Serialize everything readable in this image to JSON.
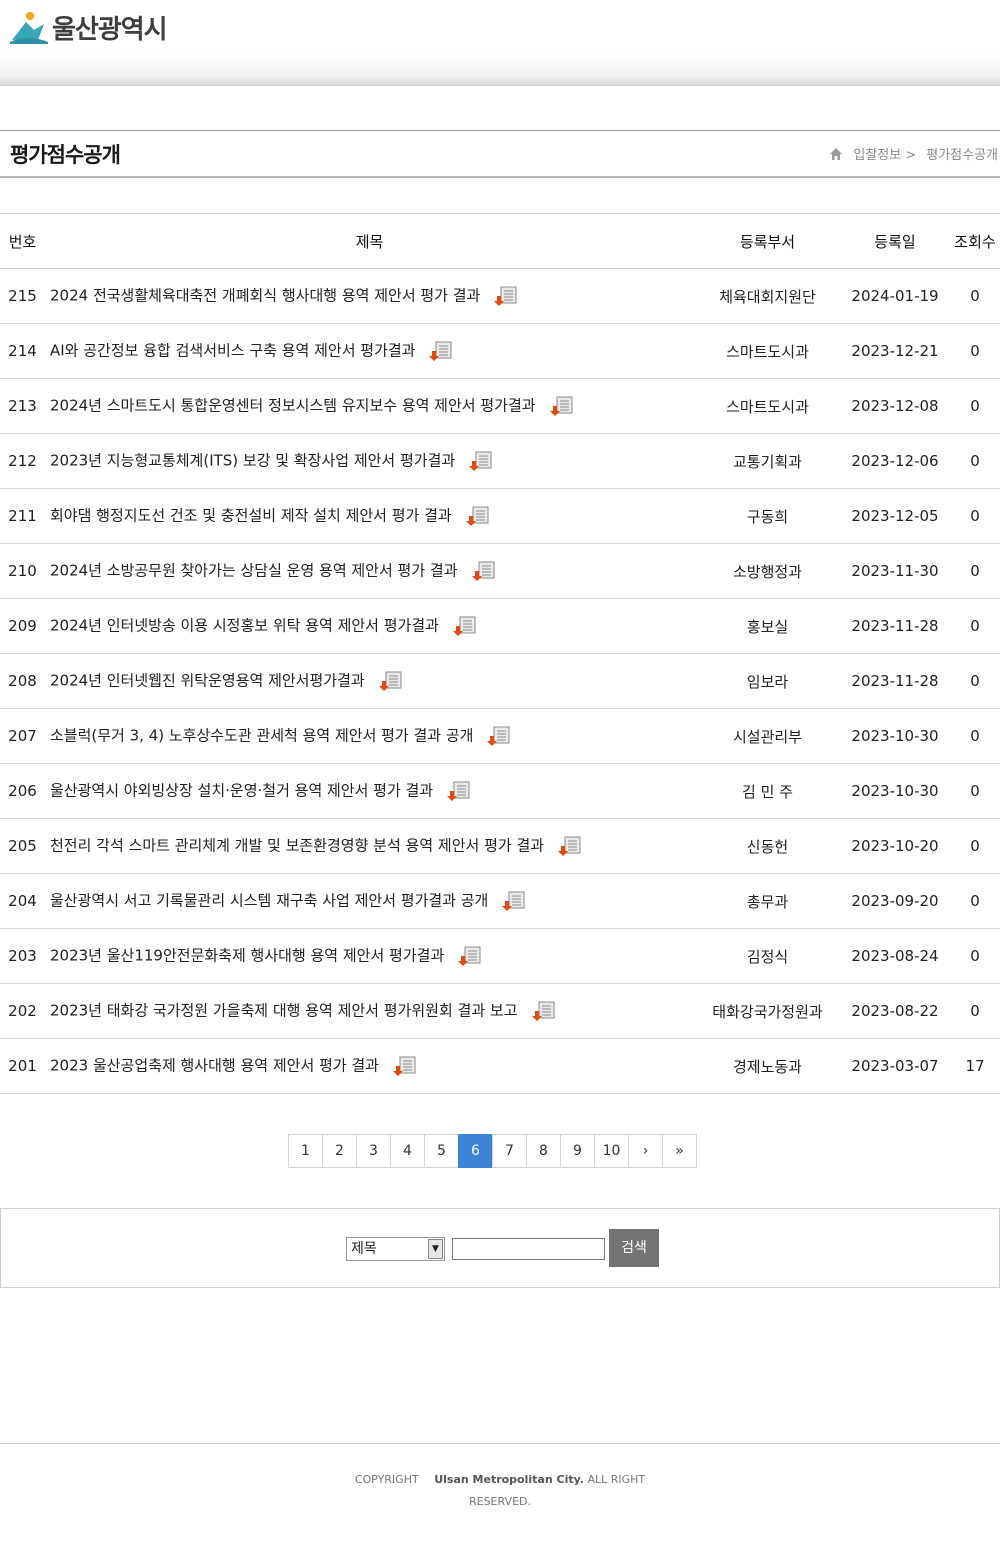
{
  "header": {
    "logo_text": "울산광역시",
    "logo_colors": {
      "mark": "#3aa6b9",
      "accent": "#f4a21b"
    }
  },
  "page": {
    "title": "평가점수공개",
    "breadcrumb": [
      "입찰정보 >",
      "평가점수공개"
    ]
  },
  "table": {
    "columns": [
      "번호",
      "제목",
      "등록부서",
      "등록일",
      "조회수"
    ],
    "rows": [
      {
        "no": "215",
        "title": "2024 전국생활체육대축전 개폐회식 행사대행 용역 제안서 평가 결과",
        "dept": "체육대회지원단",
        "date": "2024-01-19",
        "views": "0"
      },
      {
        "no": "214",
        "title": "AI와 공간정보 융합 검색서비스 구축 용역 제안서 평가결과",
        "dept": "스마트도시과",
        "date": "2023-12-21",
        "views": "0"
      },
      {
        "no": "213",
        "title": "2024년 스마트도시 통합운영센터 정보시스템 유지보수 용역 제안서 평가결과",
        "dept": "스마트도시과",
        "date": "2023-12-08",
        "views": "0"
      },
      {
        "no": "212",
        "title": "2023년 지능형교통체계(ITS) 보강 및 확장사업 제안서 평가결과",
        "dept": "교통기획과",
        "date": "2023-12-06",
        "views": "0"
      },
      {
        "no": "211",
        "title": "회야댐 행정지도선 건조 및 충전설비 제작 설치 제안서 평가 결과",
        "dept": "구동희",
        "date": "2023-12-05",
        "views": "0"
      },
      {
        "no": "210",
        "title": "2024년 소방공무원 찾아가는 상담실 운영 용역 제안서 평가 결과",
        "dept": "소방행정과",
        "date": "2023-11-30",
        "views": "0"
      },
      {
        "no": "209",
        "title": "2024년 인터넷방송 이용 시정홍보 위탁 용역 제안서 평가결과",
        "dept": "홍보실",
        "date": "2023-11-28",
        "views": "0"
      },
      {
        "no": "208",
        "title": "2024년 인터넷웹진 위탁운영용역 제안서평가결과",
        "dept": "임보라",
        "date": "2023-11-28",
        "views": "0"
      },
      {
        "no": "207",
        "title": "소블럭(무거 3, 4) 노후상수도관 관세척 용역 제안서 평가 결과 공개",
        "dept": "시설관리부",
        "date": "2023-10-30",
        "views": "0"
      },
      {
        "no": "206",
        "title": "울산광역시 야외빙상장 설치·운영·철거 용역 제안서 평가 결과",
        "dept": "김 민 주",
        "date": "2023-10-30",
        "views": "0"
      },
      {
        "no": "205",
        "title": "천전리 각석 스마트 관리체계 개발 및 보존환경영향 분석 용역 제안서 평가 결과",
        "dept": "신동헌",
        "date": "2023-10-20",
        "views": "0"
      },
      {
        "no": "204",
        "title": "울산광역시 서고 기록물관리 시스템 재구축 사업 제안서 평가결과 공개",
        "dept": "총무과",
        "date": "2023-09-20",
        "views": "0"
      },
      {
        "no": "203",
        "title": "2023년 울산119안전문화축제 행사대행 용역 제안서 평가결과",
        "dept": "김정식",
        "date": "2023-08-24",
        "views": "0"
      },
      {
        "no": "202",
        "title": "2023년 태화강 국가정원 가을축제 대행 용역 제안서 평가위원회 결과 보고",
        "dept": "태화강국가정원과",
        "date": "2023-08-22",
        "views": "0"
      },
      {
        "no": "201",
        "title": "2023 울산공업축제 행사대행 용역 제안서 평가 결과",
        "dept": "경제노동과",
        "date": "2023-03-07",
        "views": "17"
      }
    ]
  },
  "pagination": {
    "pages": [
      "1",
      "2",
      "3",
      "4",
      "5",
      "6",
      "7",
      "8",
      "9",
      "10"
    ],
    "current": "6",
    "next": "›",
    "last": "»",
    "active_color": "#3c84d6"
  },
  "search": {
    "select_value": "제목",
    "input_value": "",
    "button_label": "검색"
  },
  "footer": {
    "line1_prefix": "COPYRIGHT",
    "line1_org": "Ulsan Metropolitan City.",
    "line1_suffix": " ALL RIGHT",
    "line2": "RESERVED."
  }
}
